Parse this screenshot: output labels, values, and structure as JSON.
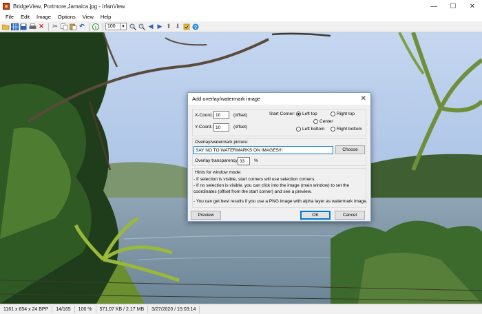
{
  "window": {
    "title": "BridgeView, Portmore,Jamaica.jpg - IrfanView",
    "minimize": "—",
    "maximize": "☐",
    "close": "✕"
  },
  "menu": [
    "File",
    "Edit",
    "Image",
    "Options",
    "View",
    "Help"
  ],
  "toolbar": {
    "zoom_value": "100",
    "icons": [
      "open-folder-icon",
      "thumbnails-icon",
      "save-icon",
      "print-icon",
      "delete-icon",
      "cut-icon",
      "copy-icon",
      "paste-icon",
      "undo-icon",
      "info-icon",
      "zoom-in-icon",
      "zoom-out-icon",
      "previous-icon",
      "next-icon",
      "upload-icon",
      "settings-icon",
      "help-icon"
    ]
  },
  "status": {
    "dimensions": "1161 x 654 x 24 BPP",
    "index": "14/165",
    "zoom": "100 %",
    "size": "571.07 KB / 2.17 MB",
    "datetime": "3/27/2020 / 15:03:14"
  },
  "dialog": {
    "title": "Add overlay/watermark image",
    "close": "✕",
    "x_label": "X-Coord.:",
    "x_value": "10",
    "x_unit": "(offset)",
    "y_label": "Y-Coord.:",
    "y_value": "10",
    "y_unit": "(offset)",
    "start_corner_label": "Start Corner:",
    "corners": {
      "left_top": "Left top",
      "right_top": "Right top",
      "center": "Center",
      "left_bottom": "Left bottom",
      "right_bottom": "Right bottom",
      "selected": "left_top"
    },
    "picture_label": "Overlay/watermark picture:",
    "picture_value": "SAY NO TO WATERMARKS ON IMAGES!!!",
    "choose_button": "Choose",
    "transparency_label": "Overlay transparency:",
    "transparency_value": "33",
    "transparency_unit": "%",
    "hints_title": "Hints for window mode:",
    "hints": [
      "- If selection is visible, start corners will use selection corners.",
      "- If no selection is visible, you can click into the image (main window) to set the",
      "  coordinates (offset from the start corner) and see a preview.",
      "- You can get best results if you use a PNG image with alpha layer as watermark image."
    ],
    "preview_button": "Preview",
    "ok_button": "OK",
    "cancel_button": "Cancel"
  }
}
